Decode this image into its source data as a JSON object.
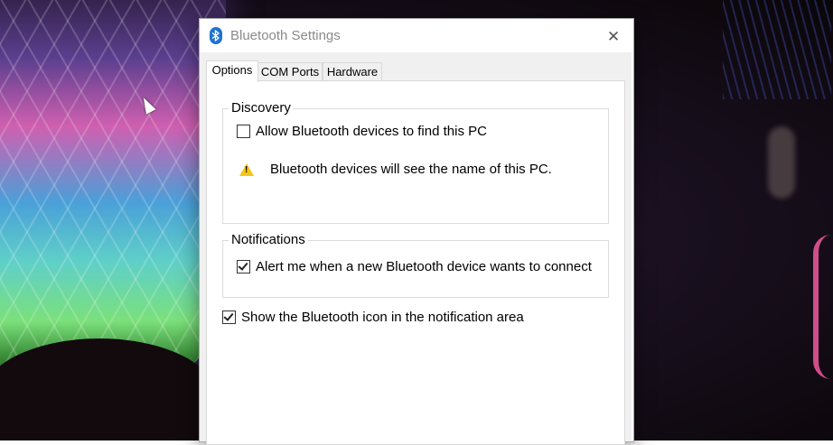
{
  "window": {
    "title": "Bluetooth Settings",
    "close_symbol": "✕",
    "icon": "bluetooth-icon"
  },
  "tabs": [
    {
      "label": "Options",
      "active": true
    },
    {
      "label": "COM Ports",
      "active": false
    },
    {
      "label": "Hardware",
      "active": false
    }
  ],
  "discovery": {
    "title": "Discovery",
    "allow_label": "Allow Bluetooth devices to find this PC",
    "allow_checked": false,
    "warning_text": "Bluetooth devices will see the name of this PC.",
    "warning_icon": "warning-icon"
  },
  "notifications": {
    "title": "Notifications",
    "alert_label": "Alert me when a new Bluetooth device wants to connect",
    "alert_checked": true
  },
  "show_icon": {
    "label": "Show the Bluetooth icon in the notification area",
    "checked": true
  },
  "colors": {
    "accent": "#1f72d0",
    "warning": "#f5c518"
  }
}
